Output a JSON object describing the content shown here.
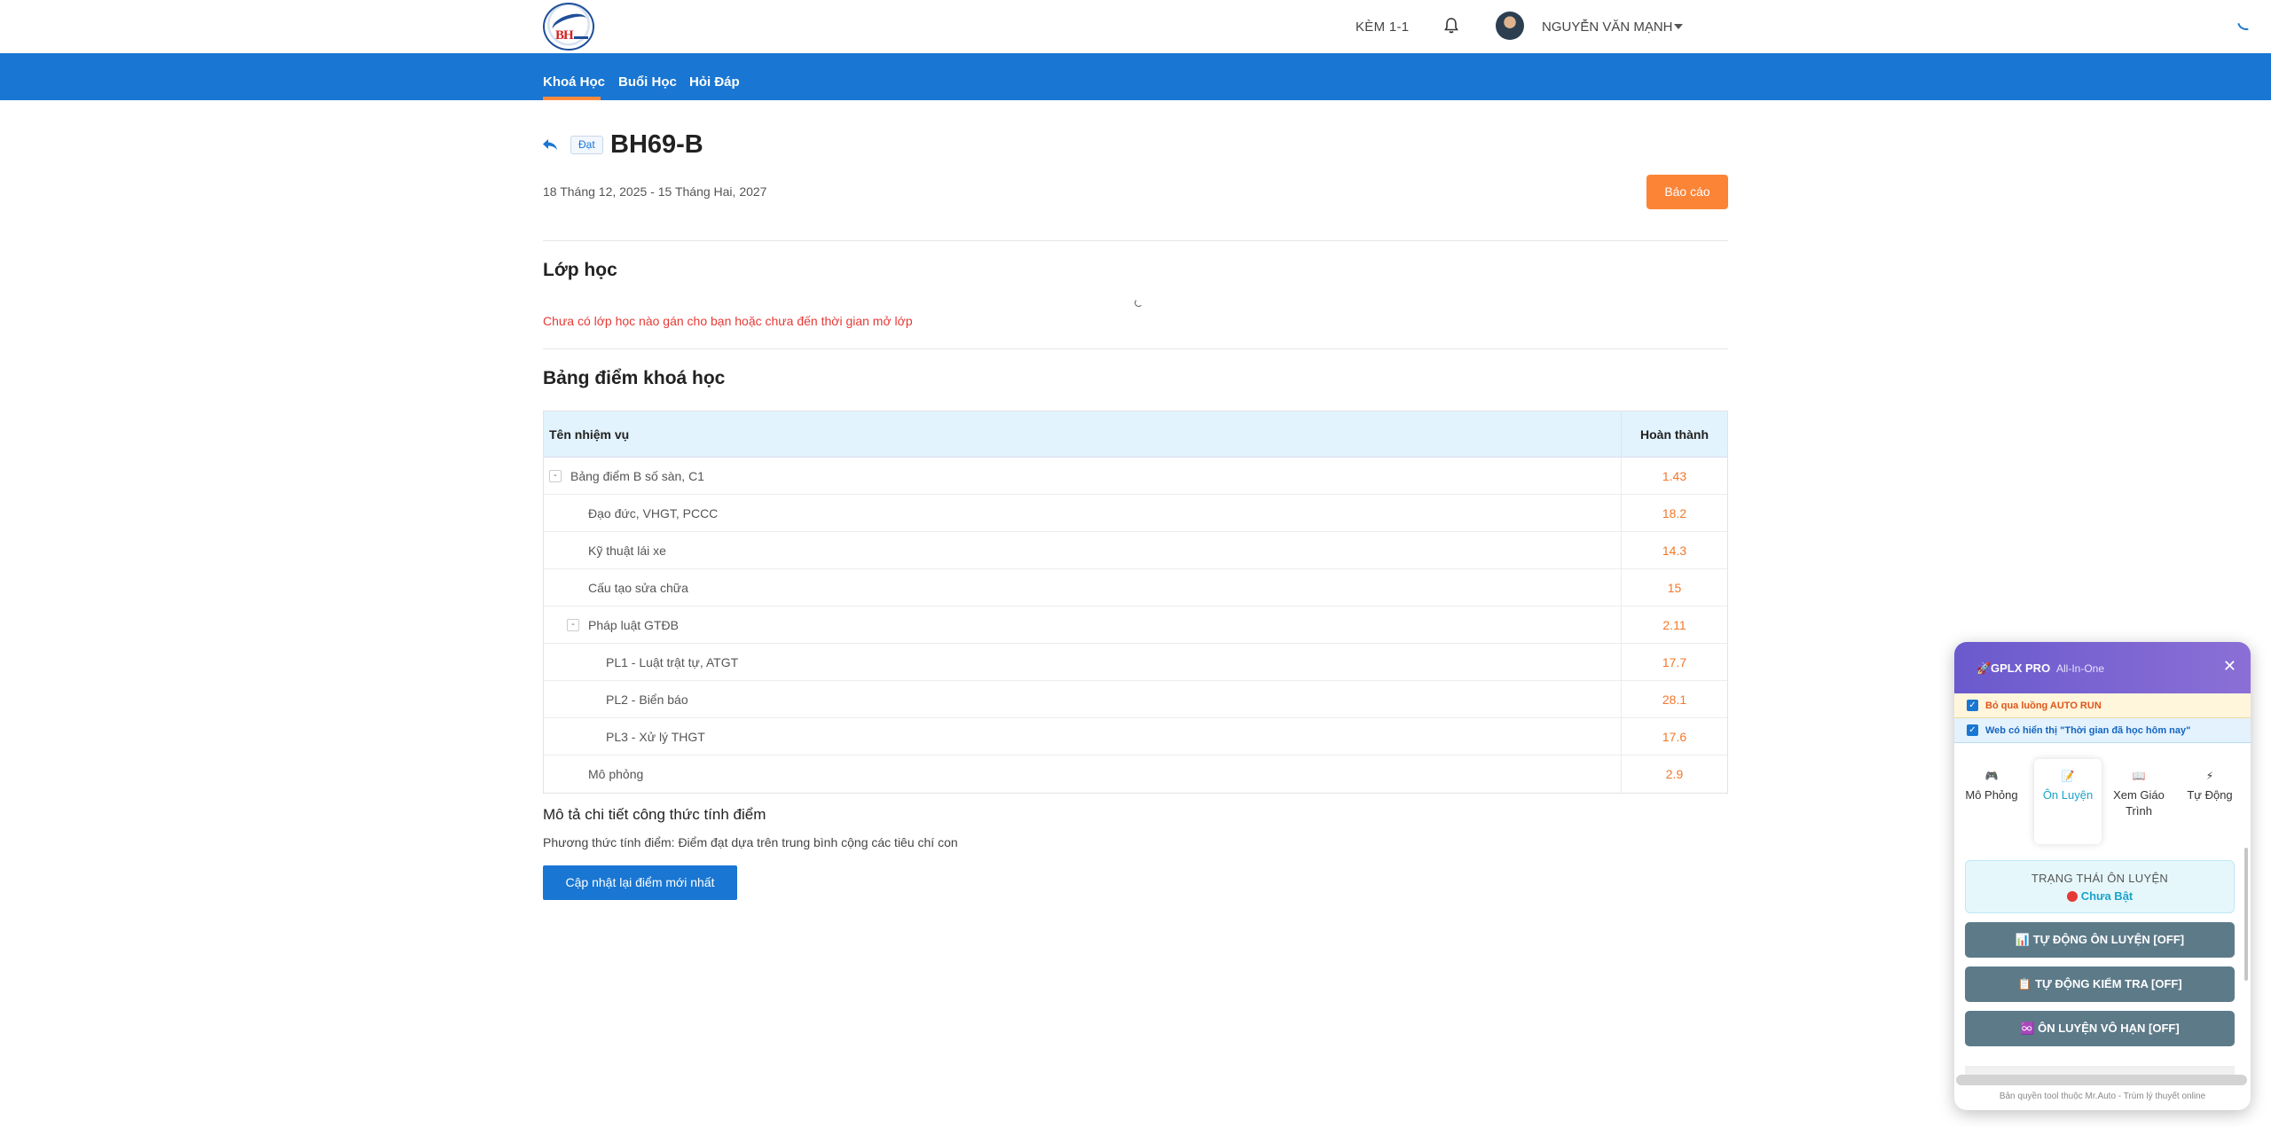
{
  "header": {
    "kem_label": "KÈM 1-1",
    "user_name": "NGUYỄN VĂN MẠNH"
  },
  "nav": {
    "items": [
      {
        "label": "Khoá Học",
        "active": true
      },
      {
        "label": "Buổi Học",
        "active": false
      },
      {
        "label": "Hỏi Đáp",
        "active": false
      }
    ]
  },
  "course": {
    "status_badge": "Đạt",
    "title": "BH69-B",
    "date_range": "18 Tháng 12, 2025 - 15 Tháng Hai, 2027",
    "report_button": "Báo cáo"
  },
  "classes": {
    "title": "Lớp học",
    "empty_message": "Chưa có lớp học nào gán cho bạn hoặc chưa đến thời gian mở lớp"
  },
  "grades": {
    "title": "Bảng điểm khoá học",
    "columns": [
      "Tên nhiệm vụ",
      "Hoàn thành"
    ],
    "rows": [
      {
        "name": "Bảng điểm B số sàn, C1",
        "value": "1.43",
        "level": 0,
        "toggle": "-"
      },
      {
        "name": "Đạo đức, VHGT, PCCC",
        "value": "18.2",
        "level": 1
      },
      {
        "name": "Kỹ thuật lái xe",
        "value": "14.3",
        "level": 1
      },
      {
        "name": "Cấu tạo sửa chữa",
        "value": "15",
        "level": 1
      },
      {
        "name": "Pháp luật GTĐB",
        "value": "2.11",
        "level": 1,
        "toggle": "-"
      },
      {
        "name": "PL1 - Luật trật tự, ATGT",
        "value": "17.7",
        "level": 2
      },
      {
        "name": "PL2 - Biển báo",
        "value": "28.1",
        "level": 2
      },
      {
        "name": "PL3 - Xử lý THGT",
        "value": "17.6",
        "level": 2
      },
      {
        "name": "Mô phỏng",
        "value": "2.9",
        "level": 1
      }
    ],
    "formula_title": "Mô tả chi tiết công thức tính điểm",
    "formula_desc": "Phương thức tính điểm: Điểm đạt dựa trên trung bình cộng các tiêu chí con",
    "update_button": "Cập nhật lại điểm mới nhất"
  },
  "tool_panel": {
    "brand": "GPLX PRO",
    "subtitle": "All-In-One",
    "close": "✕",
    "checkbox_autorun": "Bỏ qua luồng AUTO RUN",
    "checkbox_time": "Web có hiển thị \"Thời gian đã học hôm nay\"",
    "tabs": [
      {
        "label": "Mô Phỏng",
        "icon": "🎮"
      },
      {
        "label": "Ôn Luyện",
        "icon": "📝",
        "active": true
      },
      {
        "label": "Xem Giáo Trình",
        "icon": "📖"
      },
      {
        "label": "Tự Động",
        "icon": "⚡"
      }
    ],
    "status_title": "TRẠNG THÁI ÔN LUYỆN",
    "status_value": "Chưa Bật",
    "buttons": [
      "📊 TỰ ĐỘNG ÔN LUYỆN [OFF]",
      "📋 TỰ ĐỘNG KIỂM TRA [OFF]",
      "♾️ ÔN LUYỆN VÔ HẠN [OFF]"
    ],
    "footer": "Bản quyền tool thuộc Mr.Auto - Trùm lý thuyết online"
  },
  "colors": {
    "primary": "#1976d2",
    "accent_orange": "#fb8437",
    "panel_purple": "#6a5acd"
  }
}
